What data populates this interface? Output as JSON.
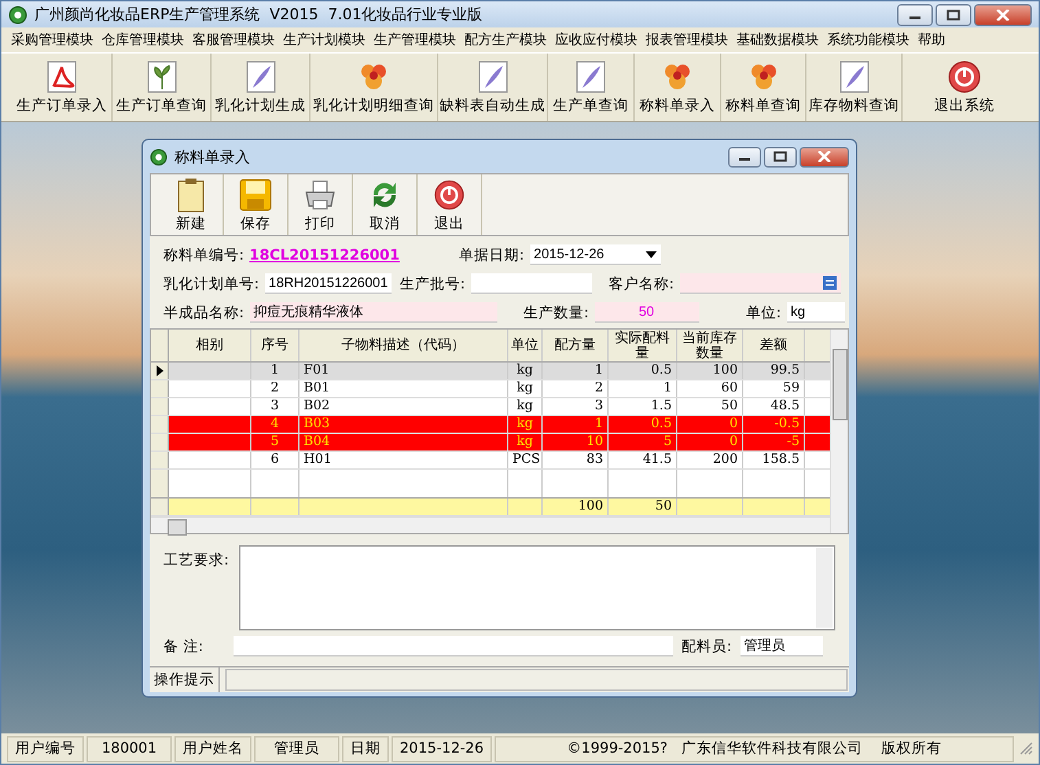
{
  "window": {
    "title": "广州颜尚化妆品ERP生产管理系统  V2015  7.01化妆品行业专业版"
  },
  "menu": [
    "采购管理模块",
    "仓库管理模块",
    "客服管理模块",
    "生产计划模块",
    "生产管理模块",
    "配方生产模块",
    "应收应付模块",
    "报表管理模块",
    "基础数据模块",
    "系统功能模块",
    "帮助"
  ],
  "toolbar": [
    {
      "label": "生产订单录入",
      "kind": "pdf"
    },
    {
      "label": "生产订单查询",
      "kind": "plant"
    },
    {
      "label": "乳化计划生成",
      "kind": "feather"
    },
    {
      "label": "乳化计划明细查询",
      "kind": "flower"
    },
    {
      "label": "缺料表自动生成",
      "kind": "feather"
    },
    {
      "label": "生产单查询",
      "kind": "feather"
    },
    {
      "label": "称料单录入",
      "kind": "flower"
    },
    {
      "label": "称料单查询",
      "kind": "flower"
    },
    {
      "label": "库存物料查询",
      "kind": "feather"
    },
    {
      "label": "退出系统",
      "kind": "exit"
    }
  ],
  "child_window": {
    "title": "称料单录入",
    "toolbar": [
      {
        "label": "新建",
        "kind": "new"
      },
      {
        "label": "保存",
        "kind": "save"
      },
      {
        "label": "打印",
        "kind": "print"
      },
      {
        "label": "取消",
        "kind": "refresh"
      },
      {
        "label": "退出",
        "kind": "exit"
      }
    ],
    "form": [
      [
        {
          "label": "称料单编号:",
          "value": "18CL20151226001",
          "kind": "link"
        },
        {
          "label": "单据日期:",
          "value": "2015-12-26",
          "kind": "date"
        }
      ],
      [
        {
          "label": "乳化计划单号:",
          "value": "18RH20151226001",
          "kind": "text"
        },
        {
          "label": "生产批号:",
          "kind": "text"
        },
        {
          "label": "客户名称:",
          "kind": "lookup"
        }
      ],
      [
        {
          "label": "半成品名称:",
          "value": "抑痘无痕精华液体",
          "kind": "readonly"
        },
        {
          "label": "生产数量:",
          "value": "50",
          "kind": "number"
        },
        {
          "label": "单位:",
          "value": "kg",
          "kind": "text"
        }
      ]
    ],
    "grid": {
      "columns": [
        "相别",
        "序号",
        "子物料描述（代码）",
        "单位",
        "配方量",
        "实际配料量",
        "当前库存数量",
        "差额"
      ],
      "rows": [
        {
          "cells": [
            null,
            "1",
            "F01",
            "kg",
            "1",
            "0.5",
            "100",
            "99.5"
          ],
          "selected": true,
          "shortage": false
        },
        {
          "cells": [
            null,
            "2",
            "B01",
            "kg",
            "2",
            "1",
            "60",
            "59"
          ],
          "selected": false,
          "shortage": false
        },
        {
          "cells": [
            null,
            "3",
            "B02",
            "kg",
            "3",
            "1.5",
            "50",
            "48.5"
          ],
          "selected": false,
          "shortage": false
        },
        {
          "cells": [
            null,
            "4",
            "B03",
            "kg",
            "1",
            "0.5",
            "0",
            "-0.5"
          ],
          "selected": false,
          "shortage": true
        },
        {
          "cells": [
            null,
            "5",
            "B04",
            "kg",
            "10",
            "5",
            "0",
            "-5"
          ],
          "selected": false,
          "shortage": true
        },
        {
          "cells": [
            null,
            "6",
            "H01",
            "PCS",
            "83",
            "41.5",
            "200",
            "158.5"
          ],
          "selected": false,
          "shortage": false
        }
      ],
      "totals": {
        "formula_amount": "100",
        "actual_amount": "50"
      }
    },
    "requirements_label": "工艺要求:",
    "remarks_label": "备 注:",
    "weigher_label": "配料员:",
    "weigher_value": "管理员",
    "hint_label": "操作提示"
  },
  "status_bar": [
    {
      "text": "用户编号",
      "kind": "label"
    },
    {
      "text": "180001",
      "kind": "value"
    },
    {
      "text": "用户姓名",
      "kind": "label"
    },
    {
      "text": "管理员",
      "kind": "value"
    },
    {
      "text": "日期",
      "kind": "label"
    },
    {
      "text": "2015-12-26",
      "kind": "value"
    },
    {
      "text": "©1999-2015?   广东信华软件科技有限公司    版权所有",
      "kind": "wide"
    }
  ]
}
